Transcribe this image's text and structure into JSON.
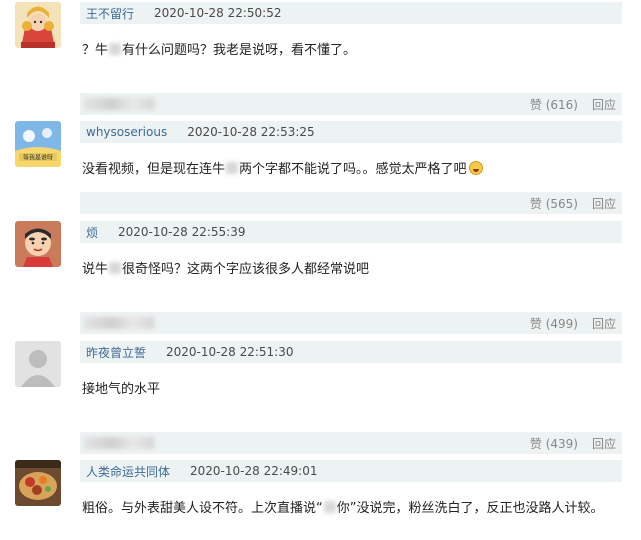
{
  "comments": [
    {
      "username": "王不留行",
      "time": "2020-10-28 22:50:52",
      "text_a": "？牛",
      "text_b": "有什么问题吗？我老是说呀，看不懂了。",
      "like_label": "赞",
      "like_count": "(616)",
      "reply_label": "回应",
      "avatar": "cartoon-girl-avatar"
    },
    {
      "username": "whysoserious",
      "time": "2020-10-28 22:53:25",
      "text_a": "没看视频，但是现在连牛",
      "text_b": "两个字都不能说了吗。。感觉太严格了吧",
      "like_label": "赞",
      "like_count": "(565)",
      "reply_label": "回应",
      "avatar": "cartoon-sky-avatar",
      "avatar_caption": "等我是谁呀"
    },
    {
      "username": "烦",
      "time": "2020-10-28 22:55:39",
      "text_a": "说牛",
      "text_b": "很奇怪吗？这两个字应该很多人都经常说吧",
      "like_label": "赞",
      "like_count": "(499)",
      "reply_label": "回应",
      "avatar": "crayon-shinchan-avatar"
    },
    {
      "username": "昨夜曾立誓",
      "time": "2020-10-28 22:51:30",
      "text_a": "接地气的水平",
      "text_b": "",
      "like_label": "赞",
      "like_count": "(439)",
      "reply_label": "回应",
      "avatar": "default-user-avatar"
    },
    {
      "username": "人类命运共同体",
      "time": "2020-10-28 22:49:01",
      "text_a": "粗俗。与外表甜美人设不符。上次直播说“",
      "text_b": "你”没说完，粉丝洗白了，反正也没路人计较。",
      "avatar": "food-photo-avatar"
    }
  ],
  "colors": {
    "username": "#3d6a98",
    "bar_bg": "#edf2f2",
    "action_text": "#888888"
  }
}
